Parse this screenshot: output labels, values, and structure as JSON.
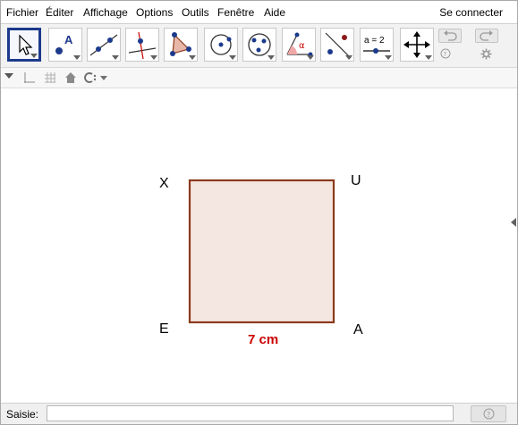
{
  "menu": {
    "items": [
      "Fichier",
      "Éditer",
      "Affichage",
      "Options",
      "Outils",
      "Fenêtre",
      "Aide"
    ],
    "signin": "Se connecter"
  },
  "toolbar": {
    "tools": [
      {
        "name": "move-tool-icon",
        "active": true
      },
      {
        "name": "point-tool-icon",
        "label": "A"
      },
      {
        "name": "line-tool-icon"
      },
      {
        "name": "perpendicular-line-tool-icon"
      },
      {
        "name": "polygon-tool-icon"
      },
      {
        "name": "circle-tool-icon"
      },
      {
        "name": "conic-tool-icon"
      },
      {
        "name": "angle-tool-icon",
        "label": "α"
      },
      {
        "name": "reflect-tool-icon"
      },
      {
        "name": "slider-tool-icon",
        "label": "a = 2"
      },
      {
        "name": "move-graphics-view-tool-icon"
      }
    ]
  },
  "graphics": {
    "points": {
      "X": "X",
      "U": "U",
      "E": "E",
      "A": "A"
    },
    "measure": "7 cm",
    "colors": {
      "square_fill": "#f4e6e1",
      "square_stroke": "#8b3a1c",
      "measure": "#cc0000",
      "accent": "#1c3a8c"
    }
  },
  "inputbar": {
    "label": "Saisie:",
    "value": "",
    "placeholder": ""
  }
}
